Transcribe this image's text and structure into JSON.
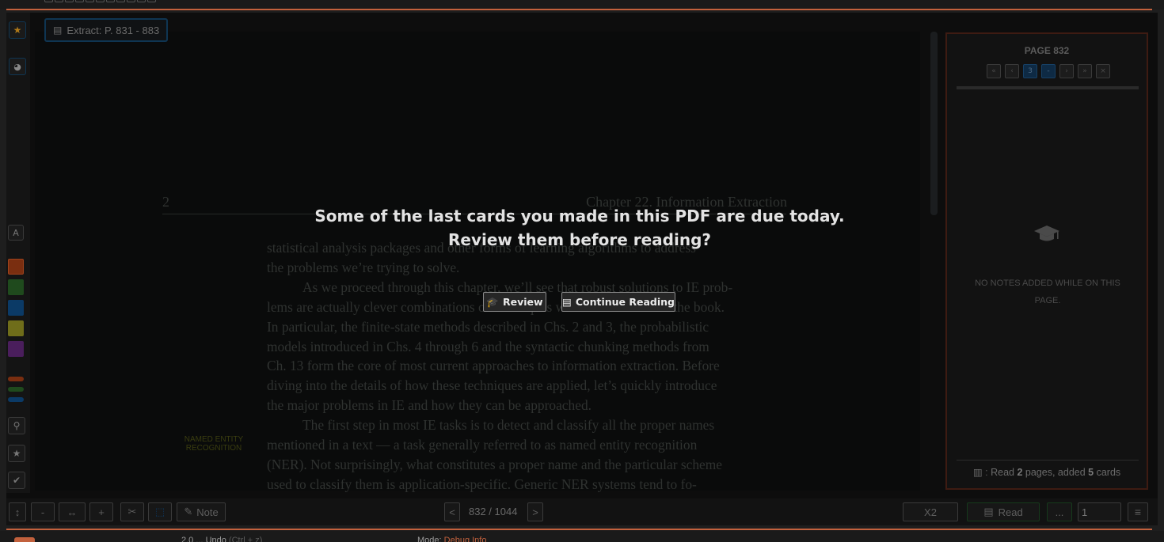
{
  "extract": {
    "label": "Extract: P. 831 - 883"
  },
  "pdf": {
    "header_page_num": "2",
    "header_chapter": "Chapter 22. Information Extraction",
    "lines": [
      "statistical analysis packages and other forms of learning algorithms to address",
      "the problems we’re trying to solve.",
      "As we proceed through this chapter, we’ll see that robust solutions to IE prob-",
      "lems are actually clever combinations of techniques we’ve seen earlier in the book.",
      "In particular, the finite-state methods described in Chs. 2 and 3, the probabilistic",
      "models introduced in Chs. 4 through 6 and the syntactic chunking methods from",
      "Ch. 13 form the core of most current approaches to information extraction. Before",
      "diving into the details of how these techniques are applied, let’s quickly introduce",
      "the major problems in IE and how they can be approached.",
      "The first step in most IE tasks is to detect and classify all the proper names",
      "mentioned in a text — a task generally referred to as named entity recognition",
      "(NER). Not surprisingly, what constitutes a proper name and the particular scheme",
      "used to classify them is application-specific. Generic NER systems tend to fo-"
    ],
    "margin_note_line1": "NAMED ENTITY",
    "margin_note_line2": "RECOGNITION"
  },
  "overlay": {
    "line1": "Some of the last cards you made in this PDF are due today.",
    "line2": "Review them before reading?",
    "review_label": "Review",
    "continue_label": "Continue Reading"
  },
  "side_panel": {
    "page_title": "PAGE 832",
    "pager": [
      "«",
      "‹",
      "3",
      "-",
      "›",
      "»",
      "×"
    ],
    "no_notes_line1": "NO NOTES ADDED WHILE ON THIS",
    "no_notes_line2": "PAGE.",
    "footer_prefix": "Read",
    "footer_pages": "2",
    "footer_mid": "pages, added",
    "footer_cards": "5",
    "footer_suffix": "cards"
  },
  "left_toolbar": {
    "text_tool": "A",
    "swatches": [
      "#7a2e10",
      "#1f4a1d",
      "#0b3a66",
      "#8a8a1e",
      "#4a1e5c"
    ],
    "mini_swatches": [
      "#7a2e10",
      "#1f4a1d",
      "#0b3a66"
    ]
  },
  "bottom_bar": {
    "minus": "-",
    "fit_width": "↔",
    "plus": "+",
    "note_label": "Note",
    "prev": "<",
    "page_counter": "832 / 1044",
    "next": ">",
    "speed_label": "X2",
    "read_label": "Read",
    "more_label": "...",
    "page_input_value": "1"
  },
  "footer": {
    "left_text": "2.0 ... Undo",
    "left_hint": "(Ctrl + z)",
    "mid_label": "Mode:",
    "mid_value": "Debug Info"
  }
}
